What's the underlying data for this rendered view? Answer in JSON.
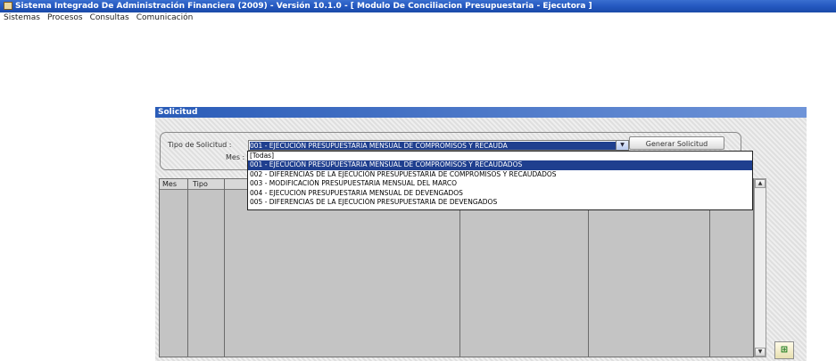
{
  "app": {
    "title": "Sistema Integrado De Administración Financiera (2009) - Versión 10.1.0 - [ Modulo De Conciliacion Presupuestaria - Ejecutora ]"
  },
  "menu": [
    "Sistemas",
    "Procesos",
    "Consultas",
    "Comunicación"
  ],
  "window": {
    "title": "Solicitud",
    "tipo_label": "Tipo de Solicitud :",
    "mes_label": "Mes :",
    "tipo_value": "001 - EJECUCIÓN PRESUPUESTARIA MENSUAL DE COMPROMISOS Y RECAUDA",
    "generate_label": "Generar Solicitud"
  },
  "grid": {
    "columns": [
      "Mes",
      "Tipo"
    ]
  },
  "dropdown": {
    "selected_index": 1,
    "options": [
      "[Todas]",
      "001 - EJECUCIÓN PRESUPUESTARIA MENSUAL DE COMPROMISOS Y RECAUDADOS",
      "002 - DIFERENCIAS DE LA EJECUCIÓN PRESUPUESTARIA DE COMPROMISOS Y RECAUDADOS",
      "003 - MODIFICACIÓN PRESUPUESTARIA MENSUAL DEL MARCO",
      "004 - EJECUCIÓN PRESUPUESTARIA MENSUAL DE DEVENGADOS",
      "005 - DIFERENCIAS DE LA EJECUCIÓN PRESUPUESTARIA DE DEVENGADOS"
    ]
  },
  "icons": {
    "app": "app-window-icon",
    "combo_arrow": "chevron-down-icon",
    "export": "excel-export-icon"
  },
  "colors": {
    "titlebar": "#2458c0",
    "selection": "#1f3f8f"
  }
}
